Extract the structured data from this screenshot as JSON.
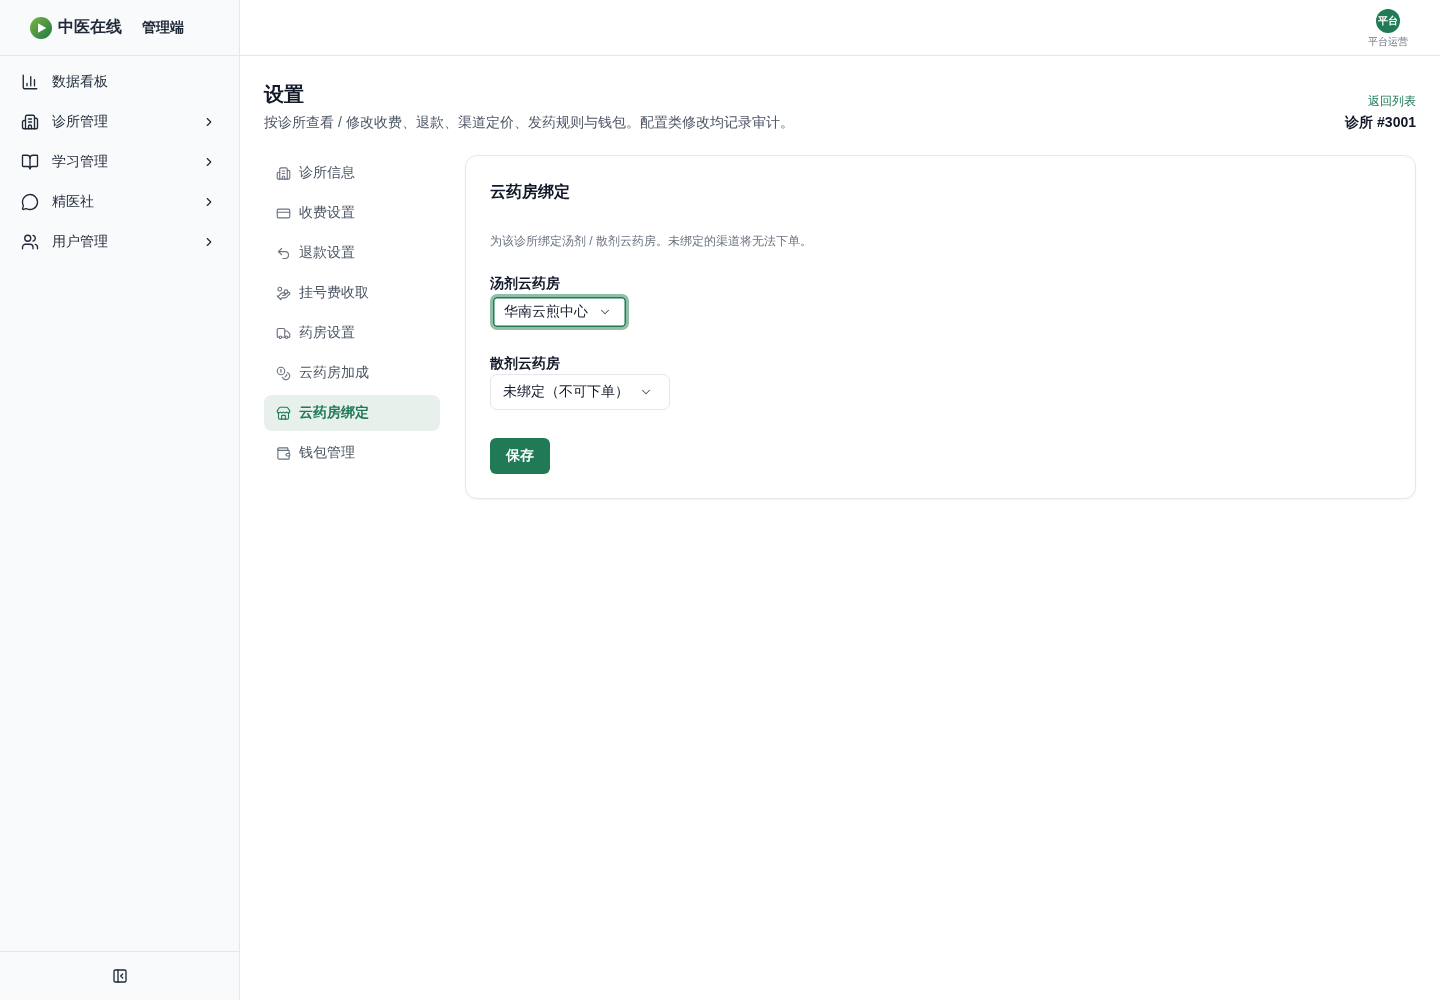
{
  "brand": {
    "name": "中医在线",
    "subtitle": "管理端"
  },
  "sidebar": {
    "items": [
      {
        "label": "数据看板",
        "has_submenu": false
      },
      {
        "label": "诊所管理",
        "has_submenu": true
      },
      {
        "label": "学习管理",
        "has_submenu": true
      },
      {
        "label": "精医社",
        "has_submenu": true
      },
      {
        "label": "用户管理",
        "has_submenu": true
      }
    ]
  },
  "user": {
    "avatar_text": "平台",
    "role": "平台运营"
  },
  "page": {
    "title": "设置",
    "subtitle": "按诊所查看 / 修改收费、退款、渠道定价、发药规则与钱包。配置类修改均记录审计。",
    "back_link": "返回列表",
    "clinic": "诊所 #3001"
  },
  "settings_nav": [
    {
      "label": "诊所信息",
      "selected": false
    },
    {
      "label": "收费设置",
      "selected": false
    },
    {
      "label": "退款设置",
      "selected": false
    },
    {
      "label": "挂号费收取",
      "selected": false
    },
    {
      "label": "药房设置",
      "selected": false
    },
    {
      "label": "云药房加成",
      "selected": false
    },
    {
      "label": "云药房绑定",
      "selected": true
    },
    {
      "label": "钱包管理",
      "selected": false
    }
  ],
  "panel": {
    "title": "云药房绑定",
    "description": "为该诊所绑定汤剂 / 散剂云药房。未绑定的渠道将无法下单。",
    "fields": [
      {
        "label": "汤剂云药房",
        "value": "华南云煎中心",
        "focused": true
      },
      {
        "label": "散剂云药房",
        "value": "未绑定（不可下单）",
        "focused": false
      }
    ],
    "save_button": "保存"
  }
}
